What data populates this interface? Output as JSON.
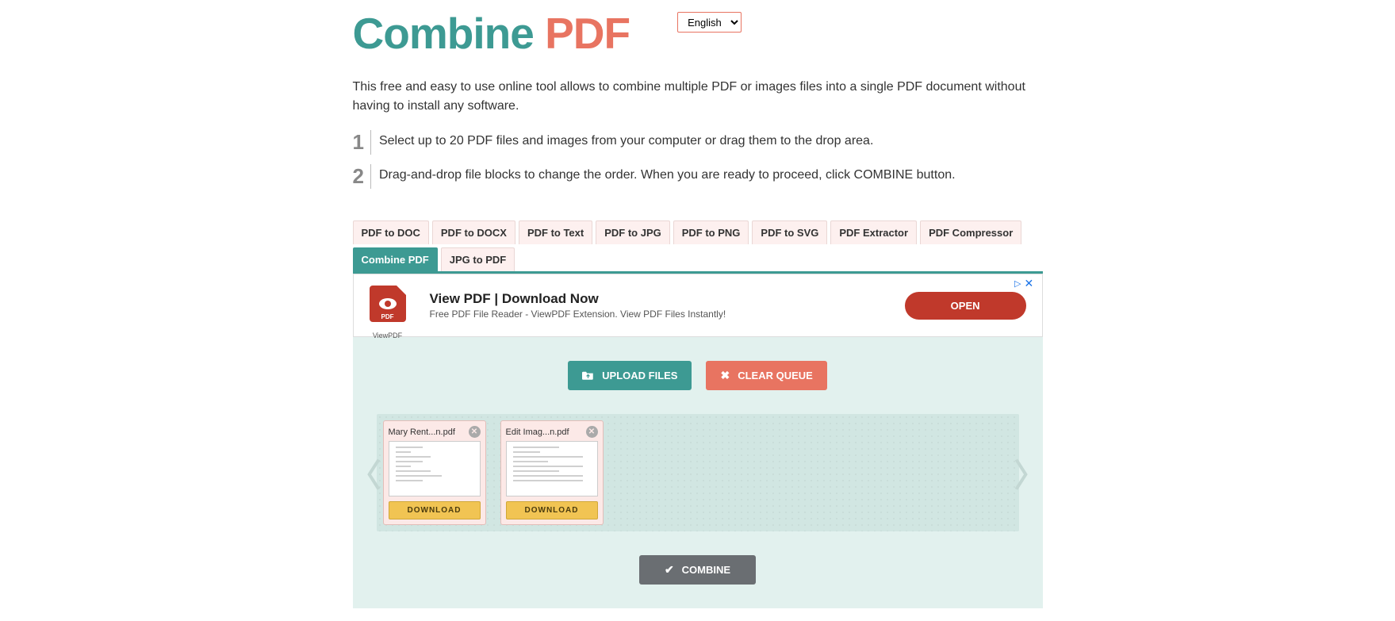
{
  "logo": {
    "word1": "Combine",
    "word2": "PDF"
  },
  "language": {
    "selected": "English"
  },
  "intro": "This free and easy to use online tool allows to combine multiple PDF or images files into a single PDF document without having to install any software.",
  "steps": [
    {
      "num": "1",
      "text": "Select up to 20 PDF files and images from your computer or drag them to the drop area."
    },
    {
      "num": "2",
      "text": "Drag-and-drop file blocks to change the order. When you are ready to proceed, click COMBINE button."
    }
  ],
  "tabs": [
    {
      "label": "PDF to DOC",
      "active": false
    },
    {
      "label": "PDF to DOCX",
      "active": false
    },
    {
      "label": "PDF to Text",
      "active": false
    },
    {
      "label": "PDF to JPG",
      "active": false
    },
    {
      "label": "PDF to PNG",
      "active": false
    },
    {
      "label": "PDF to SVG",
      "active": false
    },
    {
      "label": "PDF Extractor",
      "active": false
    },
    {
      "label": "PDF Compressor",
      "active": false
    },
    {
      "label": "Combine PDF",
      "active": true
    },
    {
      "label": "JPG to PDF",
      "active": false
    }
  ],
  "ad": {
    "icon_badge": "PDF",
    "icon_caption": "ViewPDF",
    "title": "View PDF | Download Now",
    "subtitle": "Free PDF File Reader - ViewPDF Extension. View PDF Files Instantly!",
    "button": "OPEN",
    "close_icon": "✕",
    "info_icon": "▷"
  },
  "buttons": {
    "upload": "UPLOAD FILES",
    "clear": "CLEAR QUEUE",
    "combine": "COMBINE"
  },
  "nav": {
    "left": "〈",
    "right": "〉"
  },
  "files": [
    {
      "name": "Mary Rent...n.pdf",
      "download": "DOWNLOAD"
    },
    {
      "name": "Edit Imag...n.pdf",
      "download": "DOWNLOAD"
    }
  ]
}
